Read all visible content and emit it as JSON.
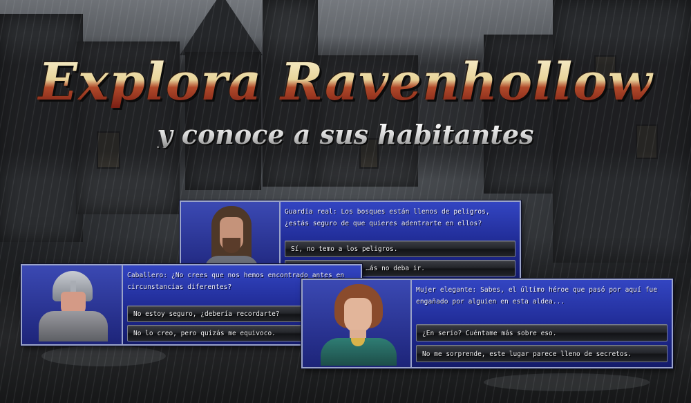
{
  "title": {
    "main": "Explora Ravenhollow",
    "sub": "y conoce a sus habitantes"
  },
  "dialogues": {
    "guard": {
      "line": "Guardia real: Los bosques están llenos de peligros, ¿estás seguro de que quieres adentrarte en ellos?",
      "options": [
        "Sí, no temo a los peligros.",
        "…ás no deba ir."
      ]
    },
    "knight": {
      "line": "Caballero: ¿No crees que nos hemos encontrado antes en circunstancias diferentes?",
      "options": [
        "No estoy seguro, ¿debería recordarte?",
        "No lo creo, pero quizás me equivoco."
      ]
    },
    "lady": {
      "line": "Mujer elegante: Sabes, el último héroe que pasó por aquí fue engañado por alguien en esta aldea...",
      "options": [
        "¿En serio? Cuéntame más sobre eso.",
        "No me sorprende, este lugar parece lleno de secretos."
      ]
    }
  },
  "colors": {
    "dialog_top": "#3345c2",
    "dialog_bottom": "#141b6a",
    "title_gold": "#e8d49a",
    "title_red": "#7a1e14"
  }
}
